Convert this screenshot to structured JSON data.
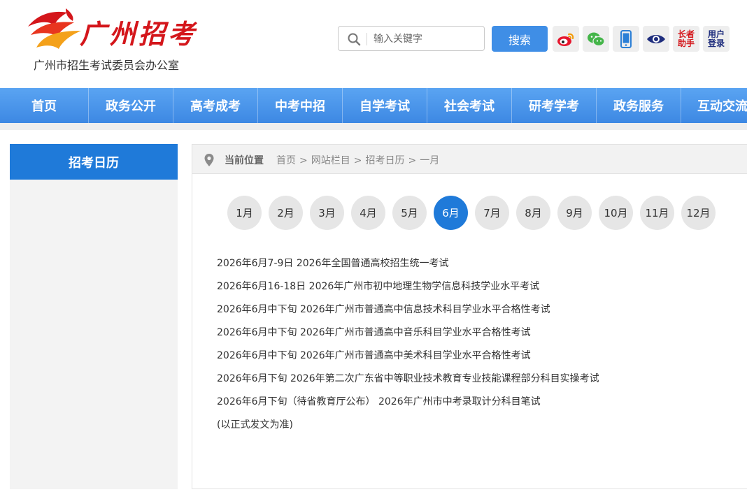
{
  "header": {
    "logo_title": "广州招考",
    "logo_subtitle": "广州市招生考试委员会办公室",
    "search": {
      "placeholder": "输入关键字",
      "button_label": "搜索"
    },
    "tools": [
      {
        "icon": "weibo-icon"
      },
      {
        "icon": "wechat-icon"
      },
      {
        "icon": "mobile-icon"
      },
      {
        "icon": "eye-icon"
      },
      {
        "label": "长者\n助手"
      },
      {
        "label": "用户\n登录"
      }
    ]
  },
  "nav": {
    "items": [
      "首页",
      "政务公开",
      "高考成考",
      "中考中招",
      "自学考试",
      "社会考试",
      "研考学考",
      "政务服务",
      "互动交流"
    ]
  },
  "sidebar": {
    "title": "招考日历"
  },
  "breadcrumb": {
    "label": "当前位置",
    "items": [
      "首页",
      "网站栏目",
      "招考日历",
      "一月"
    ],
    "separator": ">"
  },
  "months": {
    "items": [
      "1月",
      "2月",
      "3月",
      "4月",
      "5月",
      "6月",
      "7月",
      "8月",
      "9月",
      "10月",
      "11月",
      "12月"
    ],
    "active": "6月"
  },
  "events": [
    "2026年6月7-9日 2026年全国普通高校招生统一考试",
    "2026年6月16-18日 2026年广州市初中地理生物学信息科技学业水平考试",
    "2026年6月中下旬 2026年广州市普通高中信息技术科目学业水平合格性考试",
    "2026年6月中下旬 2026年广州市普通高中音乐科目学业水平合格性考试",
    "2026年6月中下旬 2026年广州市普通高中美术科目学业水平合格性考试",
    "2026年6月下旬 2026年第二次广东省中等职业技术教育专业技能课程部分科目实操考试",
    "2026年6月下旬（待省教育厅公布） 2026年广州市中考录取计分科目笔试",
    "(以正式发文为准)"
  ],
  "colors": {
    "brand_red": "#d4161b",
    "nav_blue": "#3d88e3",
    "active_blue": "#1f7ad9",
    "search_blue": "#3f8ee6"
  }
}
